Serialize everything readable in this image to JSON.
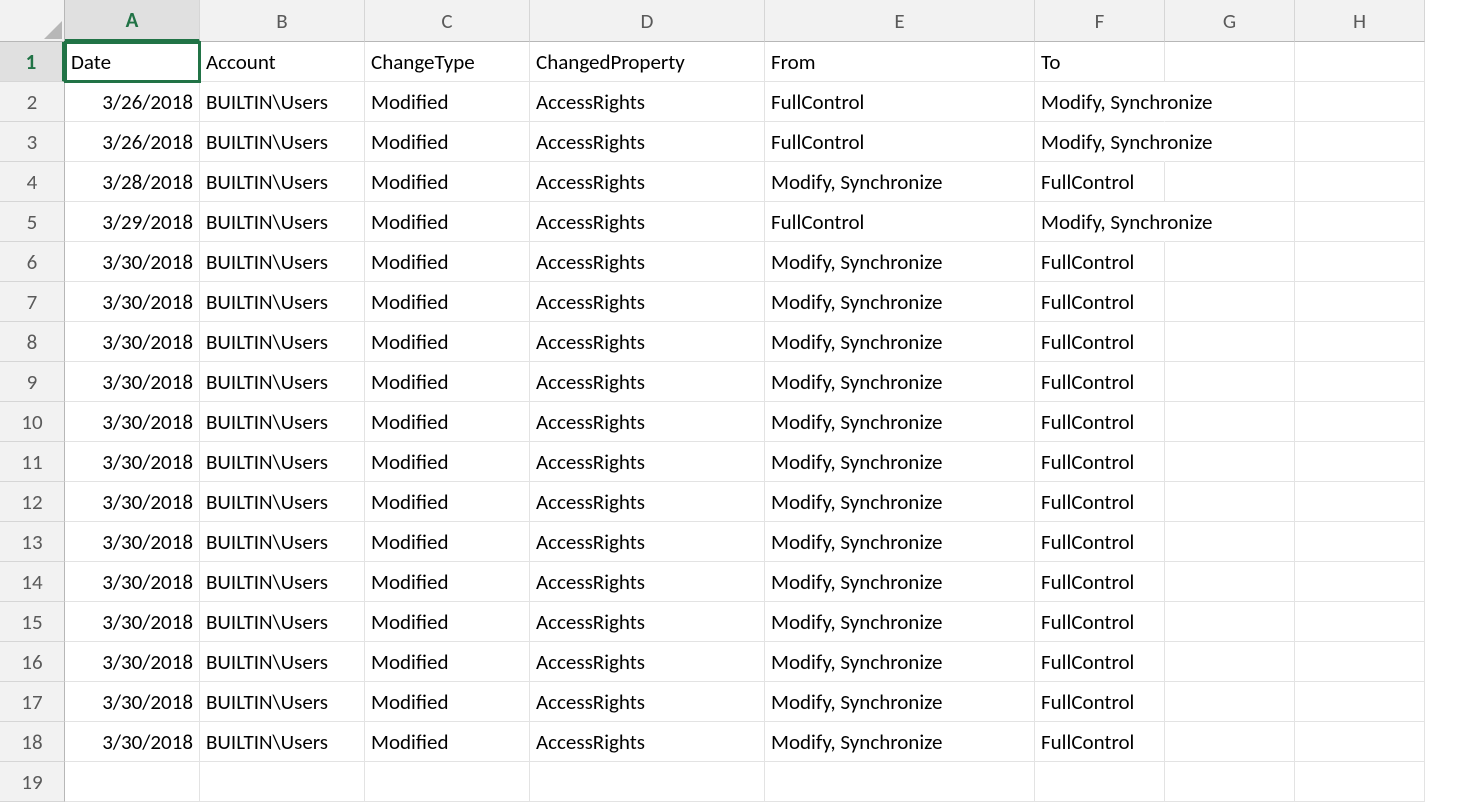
{
  "active_cell": "A1",
  "columns": [
    "A",
    "B",
    "C",
    "D",
    "E",
    "F",
    "G",
    "H"
  ],
  "row_count": 19,
  "headers": [
    "Date",
    "Account",
    "ChangeType",
    "ChangedProperty",
    "From",
    "To"
  ],
  "rows": [
    {
      "Date": "3/26/2018",
      "Account": "BUILTIN\\Users",
      "ChangeType": "Modified",
      "ChangedProperty": "AccessRights",
      "From": "FullControl",
      "To": "Modify, Synchronize"
    },
    {
      "Date": "3/26/2018",
      "Account": "BUILTIN\\Users",
      "ChangeType": "Modified",
      "ChangedProperty": "AccessRights",
      "From": "FullControl",
      "To": "Modify, Synchronize"
    },
    {
      "Date": "3/28/2018",
      "Account": "BUILTIN\\Users",
      "ChangeType": "Modified",
      "ChangedProperty": "AccessRights",
      "From": "Modify, Synchronize",
      "To": "FullControl"
    },
    {
      "Date": "3/29/2018",
      "Account": "BUILTIN\\Users",
      "ChangeType": "Modified",
      "ChangedProperty": "AccessRights",
      "From": "FullControl",
      "To": "Modify, Synchronize"
    },
    {
      "Date": "3/30/2018",
      "Account": "BUILTIN\\Users",
      "ChangeType": "Modified",
      "ChangedProperty": "AccessRights",
      "From": "Modify, Synchronize",
      "To": "FullControl"
    },
    {
      "Date": "3/30/2018",
      "Account": "BUILTIN\\Users",
      "ChangeType": "Modified",
      "ChangedProperty": "AccessRights",
      "From": "Modify, Synchronize",
      "To": "FullControl"
    },
    {
      "Date": "3/30/2018",
      "Account": "BUILTIN\\Users",
      "ChangeType": "Modified",
      "ChangedProperty": "AccessRights",
      "From": "Modify, Synchronize",
      "To": "FullControl"
    },
    {
      "Date": "3/30/2018",
      "Account": "BUILTIN\\Users",
      "ChangeType": "Modified",
      "ChangedProperty": "AccessRights",
      "From": "Modify, Synchronize",
      "To": "FullControl"
    },
    {
      "Date": "3/30/2018",
      "Account": "BUILTIN\\Users",
      "ChangeType": "Modified",
      "ChangedProperty": "AccessRights",
      "From": "Modify, Synchronize",
      "To": "FullControl"
    },
    {
      "Date": "3/30/2018",
      "Account": "BUILTIN\\Users",
      "ChangeType": "Modified",
      "ChangedProperty": "AccessRights",
      "From": "Modify, Synchronize",
      "To": "FullControl"
    },
    {
      "Date": "3/30/2018",
      "Account": "BUILTIN\\Users",
      "ChangeType": "Modified",
      "ChangedProperty": "AccessRights",
      "From": "Modify, Synchronize",
      "To": "FullControl"
    },
    {
      "Date": "3/30/2018",
      "Account": "BUILTIN\\Users",
      "ChangeType": "Modified",
      "ChangedProperty": "AccessRights",
      "From": "Modify, Synchronize",
      "To": "FullControl"
    },
    {
      "Date": "3/30/2018",
      "Account": "BUILTIN\\Users",
      "ChangeType": "Modified",
      "ChangedProperty": "AccessRights",
      "From": "Modify, Synchronize",
      "To": "FullControl"
    },
    {
      "Date": "3/30/2018",
      "Account": "BUILTIN\\Users",
      "ChangeType": "Modified",
      "ChangedProperty": "AccessRights",
      "From": "Modify, Synchronize",
      "To": "FullControl"
    },
    {
      "Date": "3/30/2018",
      "Account": "BUILTIN\\Users",
      "ChangeType": "Modified",
      "ChangedProperty": "AccessRights",
      "From": "Modify, Synchronize",
      "To": "FullControl"
    },
    {
      "Date": "3/30/2018",
      "Account": "BUILTIN\\Users",
      "ChangeType": "Modified",
      "ChangedProperty": "AccessRights",
      "From": "Modify, Synchronize",
      "To": "FullControl"
    },
    {
      "Date": "3/30/2018",
      "Account": "BUILTIN\\Users",
      "ChangeType": "Modified",
      "ChangedProperty": "AccessRights",
      "From": "Modify, Synchronize",
      "To": "FullControl"
    }
  ]
}
